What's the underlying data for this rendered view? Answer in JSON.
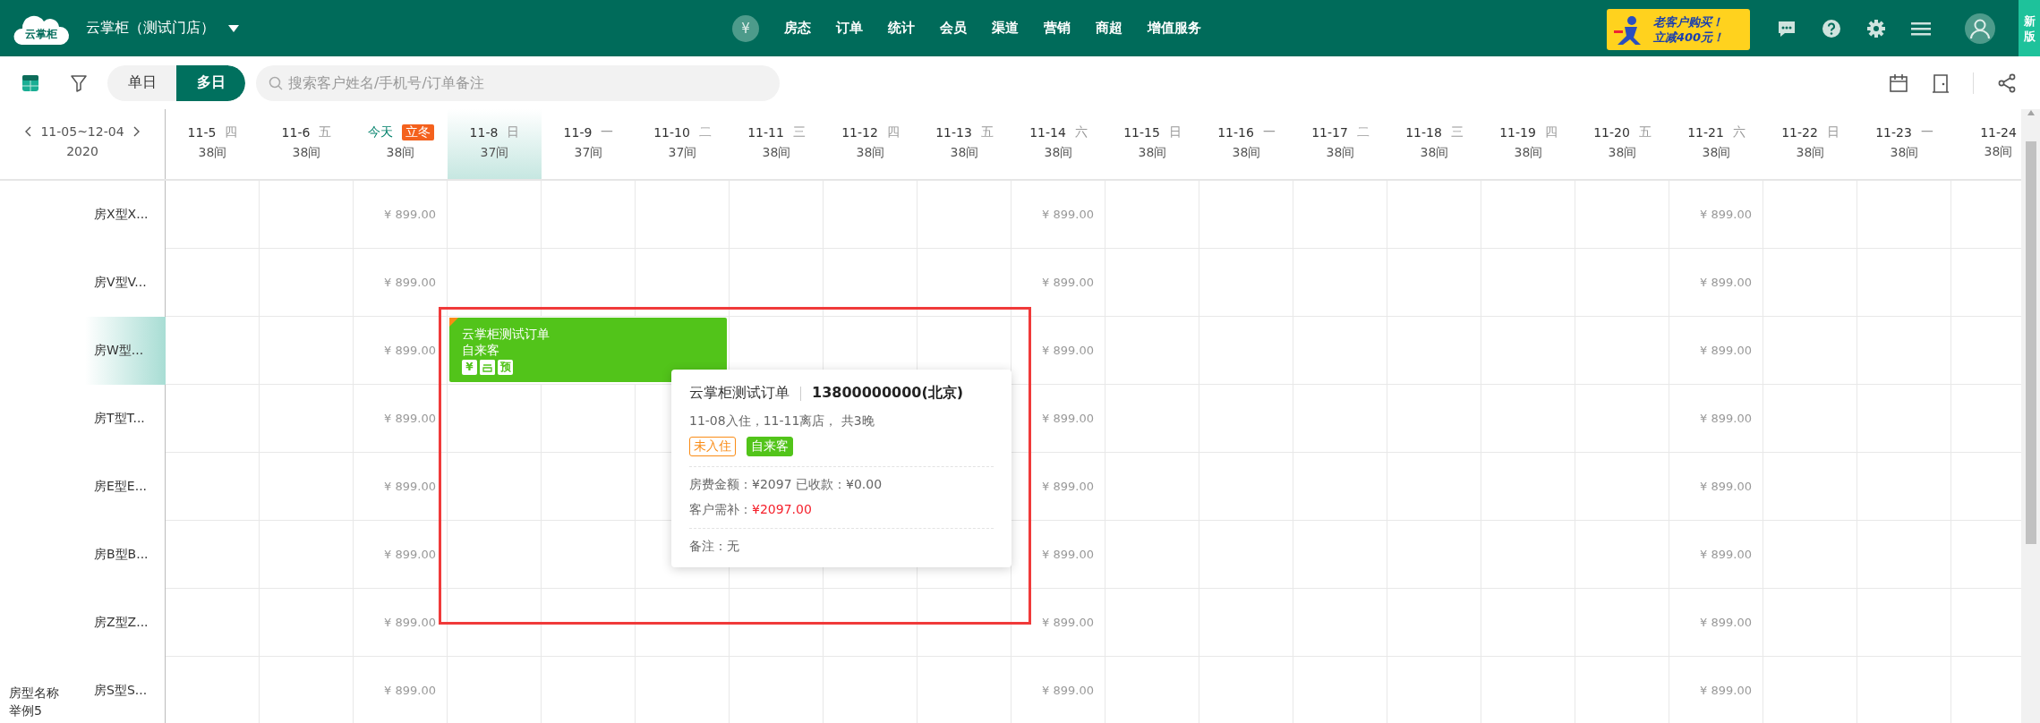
{
  "topbar": {
    "logo": "云掌柜",
    "yen_icon": "¥",
    "store": "云掌柜（测试门店）",
    "nav": [
      "房态",
      "订单",
      "统计",
      "会员",
      "渠道",
      "营销",
      "商超",
      "增值服务"
    ],
    "promo": [
      "老客户购买！",
      "立减400元！"
    ],
    "new_tab": "新版"
  },
  "toolbar": {
    "view_tabs": [
      {
        "label": "单日",
        "selected": false
      },
      {
        "label": "多日",
        "selected": true
      }
    ],
    "search": {
      "placeholder": "搜索客户姓名/手机号/订单备注"
    }
  },
  "grid": {
    "range": "11-05~12-04",
    "year": "2020",
    "columns": [
      {
        "date": "11-5",
        "weekday": "四",
        "count": "38间",
        "today": false,
        "selected": false
      },
      {
        "date": "11-6",
        "weekday": "五",
        "count": "38间",
        "today": false,
        "selected": false
      },
      {
        "date": "今天",
        "badge": "立冬",
        "count": "38间",
        "today": true,
        "selected": false
      },
      {
        "date": "11-8",
        "weekday": "日",
        "count": "37间",
        "today": false,
        "selected": true
      },
      {
        "date": "11-9",
        "weekday": "一",
        "count": "37间",
        "today": false,
        "selected": false
      },
      {
        "date": "11-10",
        "weekday": "二",
        "count": "37间",
        "today": false,
        "selected": false
      },
      {
        "date": "11-11",
        "weekday": "三",
        "count": "38间",
        "today": false,
        "selected": false
      },
      {
        "date": "11-12",
        "weekday": "四",
        "count": "38间",
        "today": false,
        "selected": false
      },
      {
        "date": "11-13",
        "weekday": "五",
        "count": "38间",
        "today": false,
        "selected": false
      },
      {
        "date": "11-14",
        "weekday": "六",
        "count": "38间",
        "today": false,
        "selected": false
      },
      {
        "date": "11-15",
        "weekday": "日",
        "count": "38间",
        "today": false,
        "selected": false
      },
      {
        "date": "11-16",
        "weekday": "一",
        "count": "38间",
        "today": false,
        "selected": false
      },
      {
        "date": "11-17",
        "weekday": "二",
        "count": "38间",
        "today": false,
        "selected": false
      },
      {
        "date": "11-18",
        "weekday": "三",
        "count": "38间",
        "today": false,
        "selected": false
      },
      {
        "date": "11-19",
        "weekday": "四",
        "count": "38间",
        "today": false,
        "selected": false
      },
      {
        "date": "11-20",
        "weekday": "五",
        "count": "38间",
        "today": false,
        "selected": false
      },
      {
        "date": "11-21",
        "weekday": "六",
        "count": "38间",
        "today": false,
        "selected": false
      },
      {
        "date": "11-22",
        "weekday": "日",
        "count": "38间",
        "today": false,
        "selected": false
      },
      {
        "date": "11-23",
        "weekday": "一",
        "count": "38间",
        "today": false,
        "selected": false
      },
      {
        "date": "11-24",
        "count": "38间",
        "today": false,
        "selected": false
      }
    ],
    "rows": [
      {
        "name": "房X型X...",
        "selected": false,
        "cells": [
          null,
          null,
          {
            "kind": "price",
            "text": "¥ 899.00"
          },
          null,
          null,
          null,
          null,
          null,
          null,
          {
            "kind": "price",
            "text": "¥ 899.00"
          },
          null,
          null,
          null,
          null,
          null,
          null,
          {
            "kind": "price",
            "text": "¥ 899.00"
          },
          null,
          null,
          null
        ]
      },
      {
        "name": "房V型V...",
        "selected": false,
        "cells": [
          null,
          null,
          {
            "kind": "price",
            "text": "¥ 899.00"
          },
          null,
          null,
          null,
          null,
          null,
          null,
          {
            "kind": "price",
            "text": "¥ 899.00"
          },
          null,
          null,
          null,
          null,
          null,
          null,
          {
            "kind": "price",
            "text": "¥ 899.00"
          },
          null,
          null,
          null
        ]
      },
      {
        "name": "房W型...",
        "selected": true,
        "cells": [
          null,
          null,
          {
            "kind": "price",
            "text": "¥ 899.00"
          },
          {
            "kind": "order",
            "name": "云掌柜测试订单",
            "source": "自来客",
            "badges": [
              {
                "kind": "text",
                "text": "¥"
              },
              {
                "kind": "icon"
              },
              {
                "kind": "text",
                "text": "预"
              }
            ]
          },
          {
            "kind": "cont"
          },
          {
            "kind": "cont"
          },
          null,
          null,
          null,
          {
            "kind": "price",
            "text": "¥ 899.00"
          },
          null,
          null,
          null,
          null,
          null,
          null,
          {
            "kind": "price",
            "text": "¥ 899.00"
          },
          null,
          null,
          null
        ]
      },
      {
        "name": "房T型T...",
        "selected": false,
        "cells": [
          null,
          null,
          {
            "kind": "price",
            "text": "¥ 899.00"
          },
          null,
          null,
          null,
          null,
          null,
          null,
          {
            "kind": "price",
            "text": "¥ 899.00"
          },
          null,
          null,
          null,
          null,
          null,
          null,
          {
            "kind": "price",
            "text": "¥ 899.00"
          },
          null,
          null,
          null
        ]
      },
      {
        "name": "房E型E...",
        "selected": false,
        "cells": [
          null,
          null,
          {
            "kind": "price",
            "text": "¥ 899.00"
          },
          null,
          null,
          null,
          null,
          null,
          null,
          {
            "kind": "price",
            "text": "¥ 899.00"
          },
          null,
          null,
          null,
          null,
          null,
          null,
          {
            "kind": "price",
            "text": "¥ 899.00"
          },
          null,
          null,
          null
        ]
      },
      {
        "name": "房B型B...",
        "selected": false,
        "cells": [
          null,
          null,
          {
            "kind": "price",
            "text": "¥ 899.00"
          },
          null,
          null,
          null,
          null,
          null,
          null,
          {
            "kind": "price",
            "text": "¥ 899.00"
          },
          null,
          null,
          null,
          null,
          null,
          null,
          {
            "kind": "price",
            "text": "¥ 899.00"
          },
          null,
          null,
          null
        ]
      },
      {
        "name": "房Z型Z...",
        "selected": false,
        "cells": [
          null,
          null,
          {
            "kind": "price",
            "text": "¥ 899.00"
          },
          null,
          null,
          null,
          null,
          null,
          null,
          {
            "kind": "price",
            "text": "¥ 899.00"
          },
          null,
          null,
          null,
          null,
          null,
          null,
          {
            "kind": "price",
            "text": "¥ 899.00"
          },
          null,
          null,
          null
        ]
      },
      {
        "group": "房型名称举例5",
        "name": "房S型S...",
        "selected": false,
        "cells": [
          null,
          null,
          {
            "kind": "price",
            "text": "¥ 899.00"
          },
          null,
          null,
          null,
          null,
          null,
          null,
          {
            "kind": "price",
            "text": "¥ 899.00"
          },
          null,
          null,
          null,
          null,
          null,
          null,
          {
            "kind": "price",
            "text": "¥ 899.00"
          },
          null,
          null,
          null
        ]
      }
    ]
  },
  "popup": {
    "title": "云掌柜测试订单",
    "phone": "13800000000(北京)",
    "stay": "11-08入住，11-11离店， 共3晚",
    "tags": [
      {
        "kind": "outline",
        "text": "未入住"
      },
      {
        "kind": "solid",
        "text": "自来客"
      }
    ],
    "fees": "房费金额：¥2097 已收款：¥0.00",
    "due_label": "客户需补：",
    "due": "¥2097.00",
    "remark": "备注：无"
  }
}
